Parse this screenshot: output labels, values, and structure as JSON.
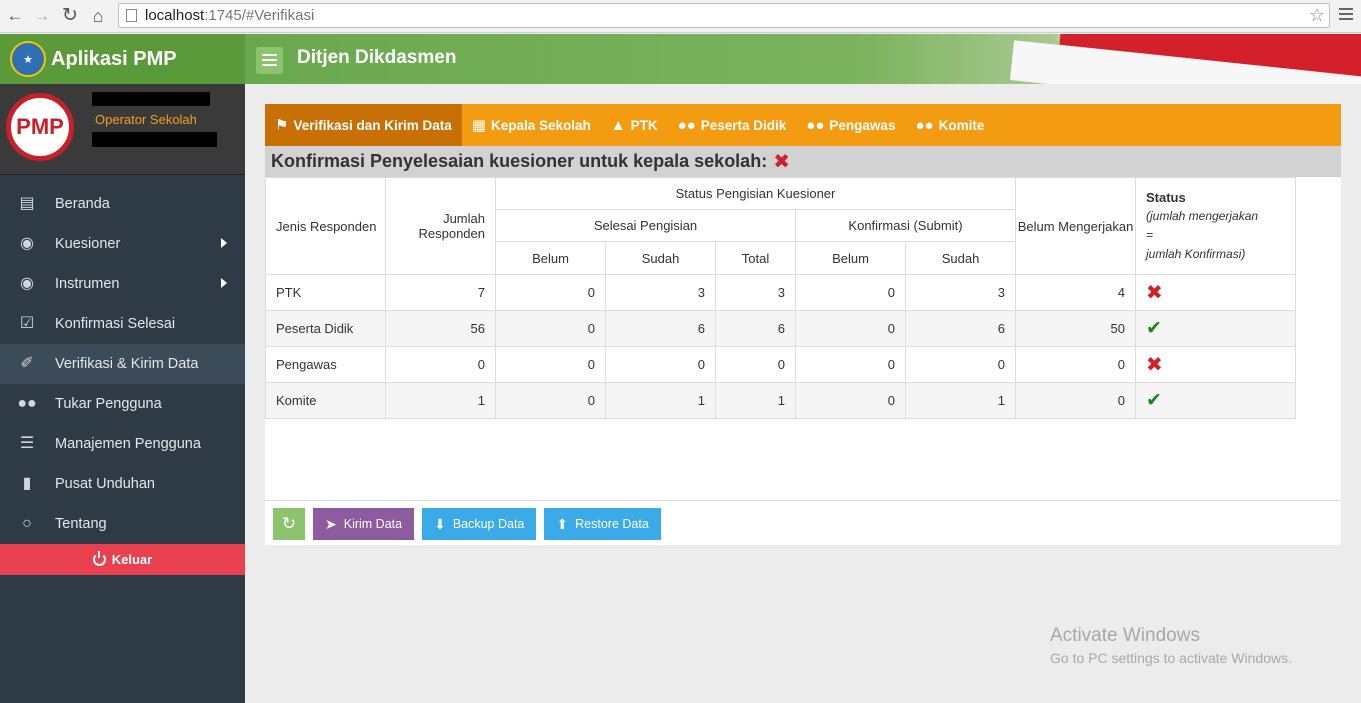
{
  "browser": {
    "url_host": "localhost",
    "url_rest": ":1745/#Verifikasi"
  },
  "sidebar": {
    "brand_title": "Aplikasi PMP",
    "logo_text": "PMP",
    "role": "Operator Sekolah",
    "items": [
      {
        "label": "Beranda",
        "icon": "monitor-icon"
      },
      {
        "label": "Kuesioner",
        "icon": "binoculars-icon"
      },
      {
        "label": "Instrumen",
        "icon": "binoculars-icon"
      },
      {
        "label": "Konfirmasi Selesai",
        "icon": "check-square-icon"
      },
      {
        "label": "Verifikasi & Kirim Data",
        "icon": "paperclip-icon"
      },
      {
        "label": "Tukar Pengguna",
        "icon": "users-icon"
      },
      {
        "label": "Manajemen Pengguna",
        "icon": "list-icon"
      },
      {
        "label": "Pusat Unduhan",
        "icon": "file-icon"
      },
      {
        "label": "Tentang",
        "icon": "comments-icon"
      }
    ],
    "logout": "Keluar"
  },
  "header": {
    "title": "Ditjen Dikdasmen"
  },
  "tabs": [
    {
      "label": "Verifikasi dan Kirim Data"
    },
    {
      "label": "Kepala Sekolah"
    },
    {
      "label": "PTK"
    },
    {
      "label": "Peserta Didik"
    },
    {
      "label": "Pengawas"
    },
    {
      "label": "Komite"
    }
  ],
  "confirm": {
    "label": "Konfirmasi Penyelesaian kuesioner untuk kepala sekolah:"
  },
  "table": {
    "h_jenis": "Jenis Responden",
    "h_jumlah": "Jumlah Responden",
    "h_status": "Status Pengisian Kuesioner",
    "h_selesai": "Selesai Pengisian",
    "h_konfirmasi": "Konfirmasi (Submit)",
    "h_belum_mengerjakan": "Belum Mengerjakan",
    "h_status_title": "Status",
    "h_status_sub1": "(jumlah mengerjakan",
    "h_status_sub2": "=",
    "h_status_sub3": "jumlah Konfirmasi)",
    "h_belum": "Belum",
    "h_sudah": "Sudah",
    "h_total": "Total",
    "h_belum2": "Belum",
    "h_sudah2": "Sudah",
    "rows": [
      {
        "jenis": "PTK",
        "jumlah": "7",
        "sel_belum": "0",
        "sel_sudah": "3",
        "sel_total": "3",
        "konf_belum": "0",
        "konf_sudah": "3",
        "belum_mengerjakan": "4",
        "ok": false
      },
      {
        "jenis": "Peserta Didik",
        "jumlah": "56",
        "sel_belum": "0",
        "sel_sudah": "6",
        "sel_total": "6",
        "konf_belum": "0",
        "konf_sudah": "6",
        "belum_mengerjakan": "50",
        "ok": true
      },
      {
        "jenis": "Pengawas",
        "jumlah": "0",
        "sel_belum": "0",
        "sel_sudah": "0",
        "sel_total": "0",
        "konf_belum": "0",
        "konf_sudah": "0",
        "belum_mengerjakan": "0",
        "ok": false
      },
      {
        "jenis": "Komite",
        "jumlah": "1",
        "sel_belum": "0",
        "sel_sudah": "1",
        "sel_total": "1",
        "konf_belum": "0",
        "konf_sudah": "1",
        "belum_mengerjakan": "0",
        "ok": true
      }
    ]
  },
  "buttons": {
    "kirim": "Kirim Data",
    "backup": "Backup Data",
    "restore": "Restore Data"
  },
  "watermark": {
    "line1": "Activate Windows",
    "line2": "Go to PC settings to activate Windows."
  }
}
